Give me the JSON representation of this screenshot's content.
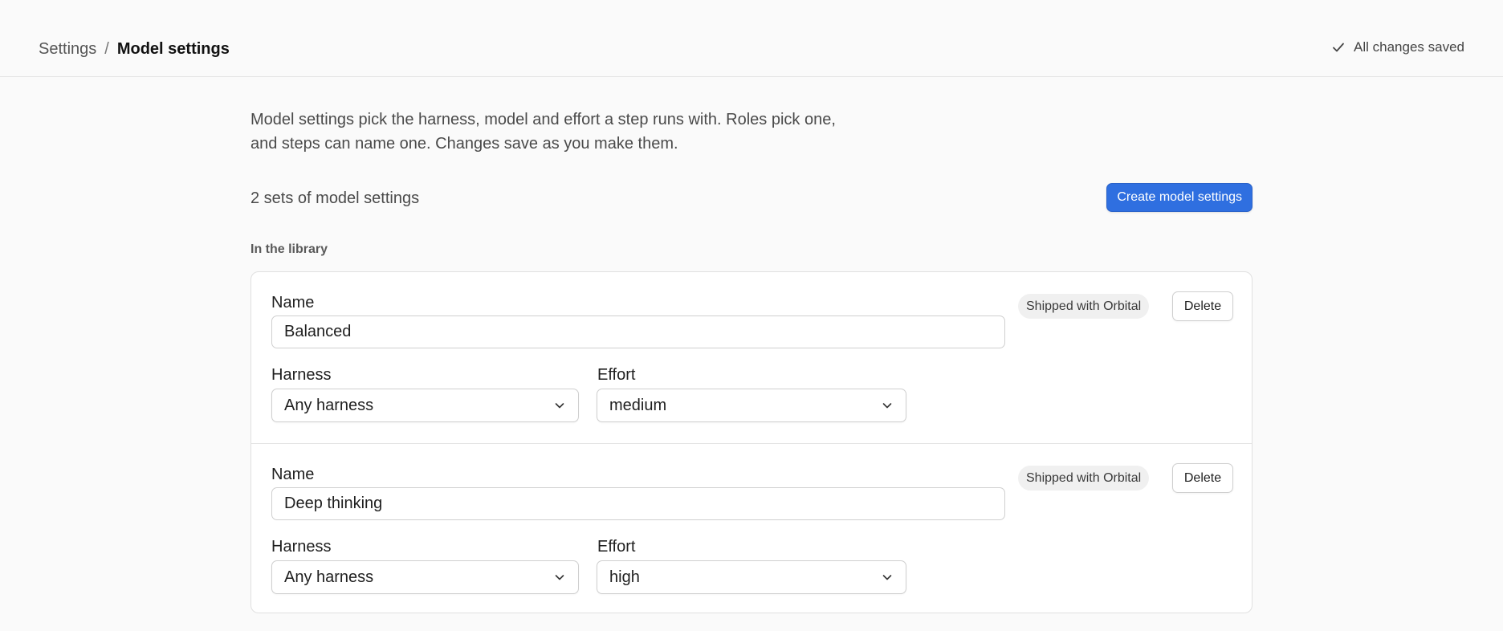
{
  "header": {
    "breadcrumb_root": "Settings",
    "breadcrumb_separator": "/",
    "breadcrumb_current": "Model settings",
    "save_status": "All changes saved",
    "save_status_icon": "check-icon"
  },
  "intro": {
    "line1": "Model settings pick the harness, model and effort a step runs with. Roles pick one,",
    "line2": "and steps can name one. Changes save as you make them."
  },
  "summary": {
    "count_text": "2 sets of model settings",
    "create_label": "Create model settings"
  },
  "library": {
    "section_label": "In the library",
    "items": [
      {
        "name_label": "Name",
        "name_value": "Balanced",
        "harness_label": "Harness",
        "harness_value": "Any harness",
        "effort_label": "Effort",
        "effort_value": "medium",
        "badge": "Shipped with Orbital",
        "delete_label": "Delete"
      },
      {
        "name_label": "Name",
        "name_value": "Deep thinking",
        "harness_label": "Harness",
        "harness_value": "Any harness",
        "effort_label": "Effort",
        "effort_value": "high",
        "badge": "Shipped with Orbital",
        "delete_label": "Delete"
      }
    ]
  },
  "colors": {
    "accent": "#2f6fe0",
    "background": "#fafafa",
    "card": "#ffffff",
    "border": "#e0e0e0"
  }
}
